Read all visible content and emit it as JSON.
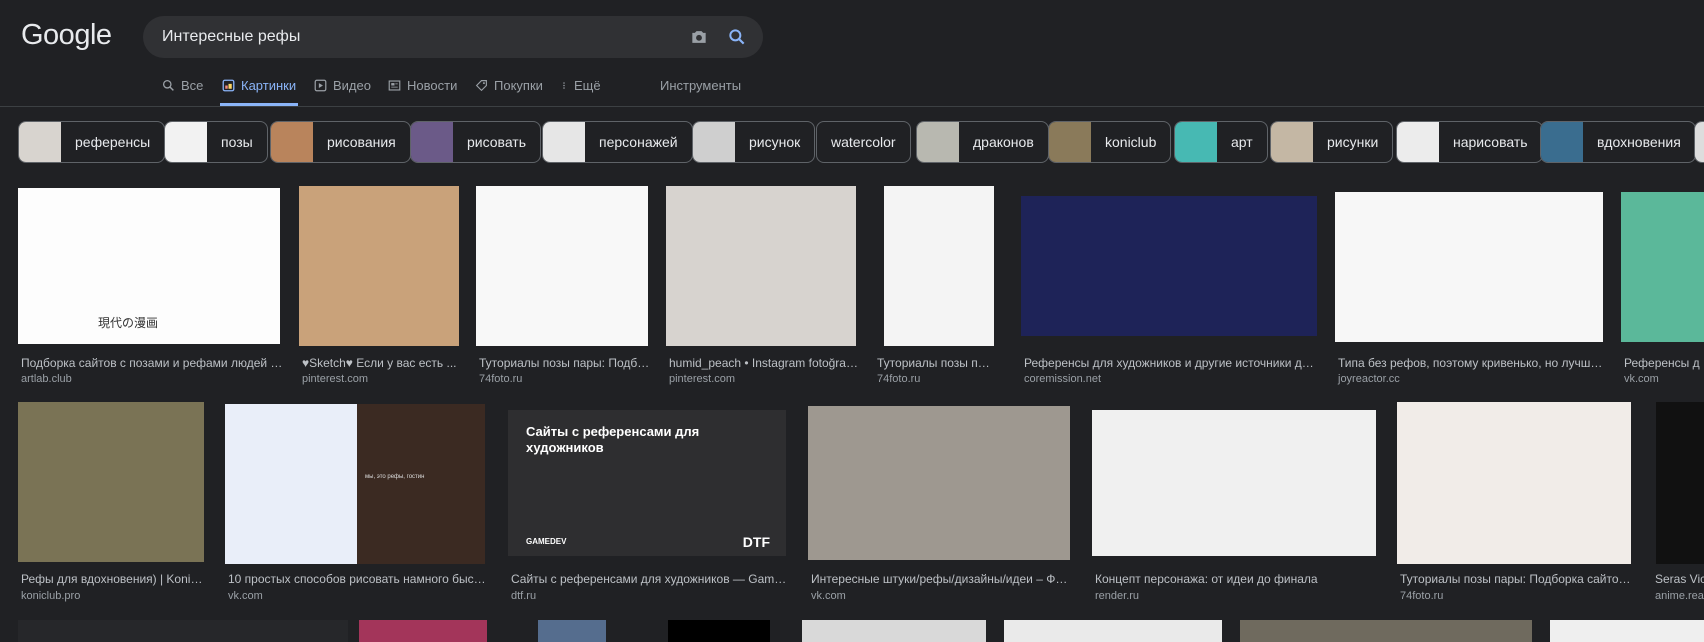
{
  "logo": "Google",
  "search": {
    "query": "Интересные рефы"
  },
  "tabs": [
    {
      "label": "Все",
      "icon": "search-icon"
    },
    {
      "label": "Картинки",
      "icon": "images-icon",
      "active": true
    },
    {
      "label": "Видео",
      "icon": "video-icon"
    },
    {
      "label": "Новости",
      "icon": "news-icon"
    },
    {
      "label": "Покупки",
      "icon": "tag-icon"
    },
    {
      "label": "Ещё",
      "icon": "more-vert-icon"
    }
  ],
  "tools_label": "Инструменты",
  "chips": [
    {
      "label": "референсы",
      "thumb": "#d8d4cf"
    },
    {
      "label": "позы",
      "thumb": "#f2f2f2"
    },
    {
      "label": "рисования",
      "thumb": "#b9845c"
    },
    {
      "label": "рисовать",
      "thumb": "#6b5a88"
    },
    {
      "label": "персонажей",
      "thumb": "#e6e6e6"
    },
    {
      "label": "рисунок",
      "thumb": "#cfcfcf"
    },
    {
      "label": "watercolor",
      "thumb": ""
    },
    {
      "label": "драконов",
      "thumb": "#b8b8b0"
    },
    {
      "label": "koniclub",
      "thumb": "#8a7a5a"
    },
    {
      "label": "арт",
      "thumb": "#47b9b3"
    },
    {
      "label": "рисунки",
      "thumb": "#c4b7a4"
    },
    {
      "label": "нарисовать",
      "thumb": "#ececec"
    },
    {
      "label": "вдохновения",
      "thumb": "#3a6d8f"
    },
    {
      "label": "",
      "thumb": "#ddd"
    }
  ],
  "results_row1": [
    {
      "title": "Подборка сайтов с позами и рефами людей | ar...",
      "source": "artlab.club",
      "bg": "#fdfdfd",
      "caption": "現代の漫画"
    },
    {
      "title": "♥Sketch♥ Если у вас есть ...",
      "source": "pinterest.com",
      "bg": "#c9a27a"
    },
    {
      "title": "Туториалы позы пары: Подбо...",
      "source": "74foto.ru",
      "bg": "#f8f8f8"
    },
    {
      "title": "humid_peach • Instagram fotoğrafl...",
      "source": "pinterest.com",
      "bg": "#d7d3cf"
    },
    {
      "title": "Туториалы позы пар...",
      "source": "74foto.ru",
      "bg": "#f4f4f4"
    },
    {
      "title": "Референсы для художников и другие источники для ...",
      "source": "coremission.net",
      "bg": "#1e2358"
    },
    {
      "title": "Типа без рефов, поэтому кривенько, но лучше б...",
      "source": "joyreactor.cc",
      "bg": "#f7f7f7"
    },
    {
      "title": "Референсы д",
      "source": "vk.com",
      "bg": "#5bb89a"
    }
  ],
  "results_row2": [
    {
      "title": "Рефы для вдохновения) | KoniClu...",
      "source": "koniclub.pro",
      "bg": "#7a7355"
    },
    {
      "title": "10 простых способов рисовать намного быстр...",
      "source": "vk.com",
      "bg": "#e9eef9",
      "inner_text": "мы, это рефы, гостин"
    },
    {
      "title": "Сайты с референсами для художников — Gamedev ...",
      "source": "dtf.ru",
      "bg": "#2e2e30",
      "overlay_title": "Сайты с референсами для художников",
      "overlay_left": "GAMEDEV",
      "overlay_right": "DTF"
    },
    {
      "title": "Интересные штуки/рефы/дизайны/идеи – Фото...",
      "source": "vk.com",
      "bg": "#9e9890"
    },
    {
      "title": "Концепт персонажа: от идеи до финала",
      "source": "render.ru",
      "bg": "#f0f0f0"
    },
    {
      "title": "Туториалы позы пары: Подборка сайтов с ...",
      "source": "74foto.ru",
      "bg": "#f1ece8"
    },
    {
      "title": "Seras Victo",
      "source": "anime.reac",
      "bg": "#111"
    }
  ]
}
